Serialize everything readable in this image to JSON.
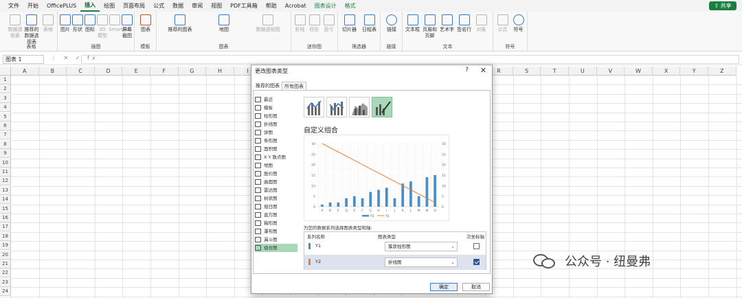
{
  "menu": {
    "items": [
      "文件",
      "开始",
      "OfficePLUS",
      "插入",
      "绘图",
      "页面布局",
      "公式",
      "数据",
      "审阅",
      "视图",
      "PDF工具箱",
      "帮助",
      "Acrobat",
      "图表设计",
      "格式"
    ],
    "active": "插入",
    "share": "共享"
  },
  "ribbon": {
    "groups": [
      {
        "label": "表格",
        "buttons": [
          "数据透视表",
          "推荐的数据透视表",
          "表格"
        ]
      },
      {
        "label": "插图",
        "buttons": [
          "图片",
          "形状",
          "图标",
          "3D 模型",
          "SmartArt",
          "屏幕截图"
        ]
      },
      {
        "label": "模板",
        "buttons": [
          "图表"
        ]
      },
      {
        "label": "图表",
        "buttons": [
          "推荐的图表",
          "地图",
          "数据透视图"
        ]
      },
      {
        "label": "迷你图",
        "buttons": [
          "折线",
          "柱形",
          "盈亏"
        ]
      },
      {
        "label": "筛选器",
        "buttons": [
          "切片器",
          "日程表"
        ]
      },
      {
        "label": "链接",
        "buttons": [
          "链接"
        ]
      },
      {
        "label": "文本",
        "buttons": [
          "文本框",
          "页眉和页脚",
          "艺术字",
          "签名行",
          "对象"
        ]
      },
      {
        "label": "符号",
        "buttons": [
          "公式",
          "符号"
        ]
      }
    ]
  },
  "formula_bar": {
    "name_box": "图表 1",
    "fx": "fx"
  },
  "sheet": {
    "columns": [
      "A",
      "B",
      "C",
      "D",
      "E",
      "F",
      "G",
      "H",
      "I",
      "J",
      "K",
      "L",
      "M",
      "N",
      "O",
      "P",
      "Q",
      "R",
      "S",
      "T",
      "U",
      "V",
      "W",
      "X",
      "Y",
      "Z"
    ],
    "rows": [
      "1",
      "2",
      "3",
      "4",
      "5",
      "6",
      "7",
      "8",
      "9",
      "10",
      "11",
      "12",
      "13",
      "14",
      "15",
      "16",
      "17",
      "18",
      "19",
      "20",
      "21",
      "22",
      "23",
      "24",
      "25"
    ]
  },
  "dialog": {
    "title": "更改图表类型",
    "help": "?",
    "close": "✕",
    "tabs": [
      "推荐的图表",
      "所有图表"
    ],
    "active_tab": "所有图表",
    "chart_types": [
      "最近",
      "模板",
      "柱形图",
      "折线图",
      "饼图",
      "条形图",
      "面积图",
      "X Y 散点图",
      "地图",
      "股价图",
      "曲面图",
      "雷达图",
      "树状图",
      "旭日图",
      "直方图",
      "箱形图",
      "瀑布图",
      "漏斗图",
      "组合图"
    ],
    "selected_type": "组合图",
    "combo_heading": "自定义组合",
    "series_caption": "为您的数据系列选择图表类型和轴:",
    "table_headers": {
      "name": "系列名称",
      "type": "图表类型",
      "secondary": "次坐标轴"
    },
    "series_rows": [
      {
        "name": "Y1",
        "type": "簇状柱形图",
        "secondary_axis": false,
        "color": "#4a8ec6"
      },
      {
        "name": "Y2",
        "type": "折线图",
        "secondary_axis": true,
        "color": "#ed7d31"
      }
    ],
    "ok": "确定",
    "cancel": "取消"
  },
  "chart_data": {
    "type": "bar",
    "categories": [
      "A",
      "B",
      "C",
      "D",
      "E",
      "F",
      "G",
      "H",
      "I",
      "J",
      "K",
      "L",
      "M",
      "N",
      "O"
    ],
    "series": [
      {
        "name": "Y1",
        "chart": "bar",
        "axis": "primary",
        "values": [
          1,
          2,
          2,
          4,
          5,
          4,
          7,
          8,
          9,
          4,
          11,
          12,
          5,
          14,
          15
        ],
        "color": "#4a8ec6"
      },
      {
        "name": "Y2",
        "chart": "line",
        "axis": "primary",
        "values": [
          30,
          28,
          26,
          24,
          22,
          20,
          18,
          16,
          14,
          12,
          10,
          8,
          6,
          4,
          2
        ],
        "color": "#ed7d31"
      }
    ],
    "ylim": [
      0,
      30
    ],
    "y2lim": [
      0,
      30
    ],
    "yticks": [
      0,
      5,
      10,
      15,
      20,
      25,
      30
    ],
    "y2ticks": [
      0,
      5,
      10,
      15,
      20,
      25,
      30
    ],
    "ylabel": "",
    "legend": [
      "Y1",
      "Y2"
    ],
    "grid": true,
    "legend_position": "bottom"
  },
  "watermark": "公众号 · 纽曼弗"
}
